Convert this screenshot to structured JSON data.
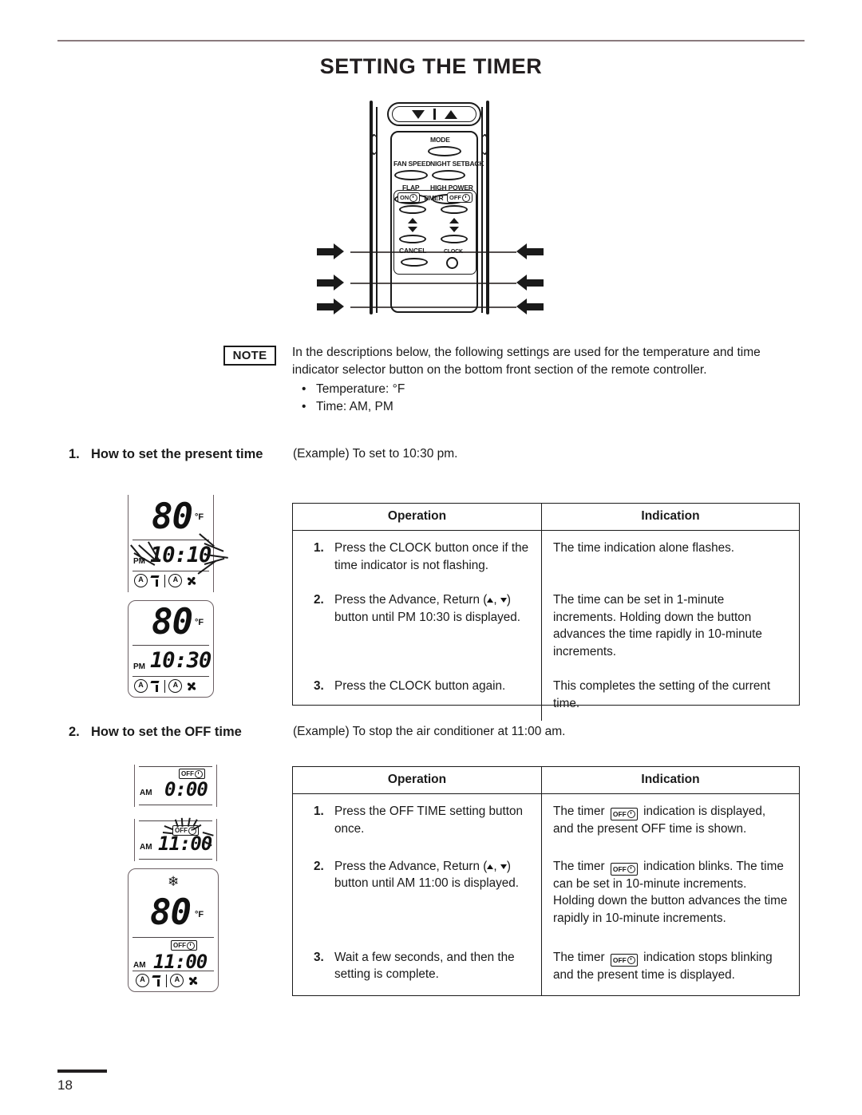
{
  "document": {
    "title": "SETTING THE TIMER",
    "page_number": "18"
  },
  "remote": {
    "buttons": {
      "mode": "MODE",
      "fan_speed": "FAN SPEED",
      "night_setback": "NIGHT SETBACK",
      "flap": "FLAP",
      "high_power": "HIGH POWER",
      "timer": "TIMER",
      "timer_on": "ON",
      "timer_off": "OFF",
      "cancel": "CANCEL",
      "clock": "CLOCK"
    }
  },
  "note": {
    "label": "NOTE",
    "body": "In the descriptions below, the following settings are used for the temperature and time indicator selector button on the bottom front section of the remote controller.",
    "bullets": [
      "Temperature: °F",
      "Time: AM, PM"
    ]
  },
  "sections": [
    {
      "number": "1.",
      "heading": "How to set the present time",
      "example": "(Example) To set to 10:30 pm.",
      "displays": [
        {
          "temperature": "80",
          "unit": "°F",
          "meridiem": "PM",
          "time": "10:10",
          "flashing": true
        },
        {
          "temperature": "80",
          "unit": "°F",
          "meridiem": "PM",
          "time": "10:30",
          "flashing": false
        }
      ],
      "table": {
        "headers": [
          "Operation",
          "Indication"
        ],
        "rows": [
          {
            "num": "1.",
            "operation": "Press the CLOCK button once if the time indicator is not flashing.",
            "indication": "The time indication alone flashes."
          },
          {
            "num": "2.",
            "operation_pre": "Press the Advance, Return (",
            "operation_post": ") button until PM 10:30 is displayed.",
            "indication": "The time can be set in 1-minute increments. Holding down the button advances the time rapidly in 10-minute increments."
          },
          {
            "num": "3.",
            "operation": "Press the CLOCK button again.",
            "indication": "This completes the setting of the current time."
          }
        ]
      }
    },
    {
      "number": "2.",
      "heading": "How to set the OFF time",
      "example": "(Example) To stop the air conditioner at 11:00 am.",
      "displays": [
        {
          "meridiem": "AM",
          "time": "0:00",
          "off_badge": "OFF",
          "flashing": false
        },
        {
          "meridiem": "AM",
          "time": "11:00",
          "off_badge": "OFF",
          "flashing": true
        },
        {
          "temperature": "80",
          "unit": "°F",
          "meridiem": "AM",
          "time": "11:00",
          "off_badge": "OFF",
          "mode_icon": "snowflake",
          "flashing": false
        }
      ],
      "table": {
        "headers": [
          "Operation",
          "Indication"
        ],
        "rows": [
          {
            "num": "1.",
            "operation": "Press the OFF TIME setting button once.",
            "indication_pre": "The timer",
            "indication_badge": "OFF",
            "indication_post": "indication is displayed, and the present OFF time is shown."
          },
          {
            "num": "2.",
            "operation_pre": "Press the Advance, Return (",
            "operation_post": ") button until AM 11:00 is displayed.",
            "indication_pre": "The timer",
            "indication_badge": "OFF",
            "indication_post": "indication blinks. The time can be set in 10-minute increments. Holding down the button advances the time rapidly in 10-minute increments."
          },
          {
            "num": "3.",
            "operation": "Wait a few seconds, and then the setting is complete.",
            "indication_pre": "The timer",
            "indication_badge": "OFF",
            "indication_post": "indication stops blinking and the present time is displayed."
          }
        ]
      }
    }
  ],
  "colors": {
    "ink": "#231f20",
    "rule": "#8a7a7d",
    "lcd_frame": "#6b5f63"
  }
}
